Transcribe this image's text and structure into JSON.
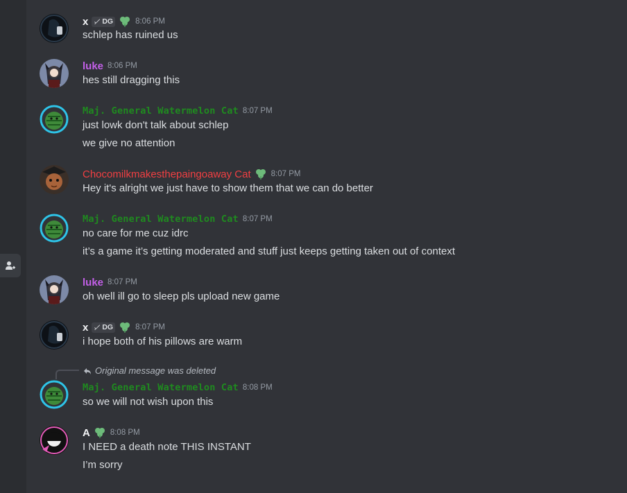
{
  "colors": {
    "background": "#313338",
    "rail": "#2b2d31",
    "luke": "#c360e8",
    "major": "#1f8b1f",
    "choco": "#f23f42",
    "white_name": "#f2f3f5",
    "role_icon": "#6dbb7a"
  },
  "sidebar": {
    "member_list_icon": "person-add-icon"
  },
  "messages": [
    {
      "author": "x",
      "tag": "DG",
      "time": "8:06 PM",
      "lines": [
        "schlep has ruined us"
      ]
    },
    {
      "author": "luke",
      "time": "8:06 PM",
      "lines": [
        "hes still dragging this"
      ]
    },
    {
      "author": "Maj. General Watermelon Cat",
      "time": "8:07 PM",
      "lines": [
        "just lowk don't talk about schlep",
        "we give no attention"
      ]
    },
    {
      "author": "Chocomilkmakesthepaingoaway Cat",
      "time": "8:07 PM",
      "lines": [
        "Hey it's alright we just have to show them that we can do better"
      ]
    },
    {
      "author": "Maj. General Watermelon Cat",
      "time": "8:07 PM",
      "lines": [
        "no care for me cuz idrc",
        "it’s a game it’s getting moderated and stuff just keeps getting taken out of context"
      ]
    },
    {
      "author": "luke",
      "time": "8:07 PM",
      "lines": [
        "oh well ill go to sleep pls upload new game"
      ]
    },
    {
      "author": "x",
      "tag": "DG",
      "time": "8:07 PM",
      "lines": [
        "i hope both of his pillows are warm"
      ]
    },
    {
      "author": "Maj. General Watermelon Cat",
      "time": "8:08 PM",
      "reply": "Original message was deleted",
      "lines": [
        "so we will not wish upon this"
      ]
    },
    {
      "author": "A",
      "time": "8:08 PM",
      "lines": [
        "I NEED a death note THIS INSTANT",
        "I’m sorry"
      ]
    }
  ]
}
